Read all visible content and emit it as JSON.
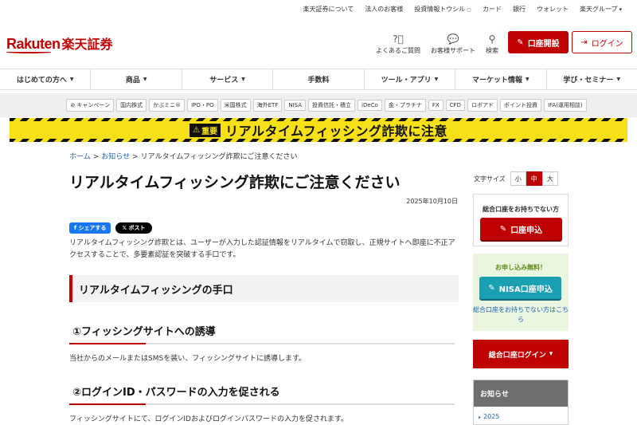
{
  "util_links": [
    "楽天証券について",
    "法人のお客様",
    "投資情報トウシル",
    "カード",
    "銀行",
    "ウォレット",
    "楽天グループ"
  ],
  "logo": {
    "en": "Rakuten",
    "jp": "楽天証券"
  },
  "header_icons": [
    {
      "icon": "question-icon",
      "label": "よくあるご質問"
    },
    {
      "icon": "chat-icon",
      "label": "お客様サポート"
    },
    {
      "icon": "search-icon",
      "label": "検索"
    }
  ],
  "open_account_label": "口座開設",
  "login_label": "ログイン",
  "gnav": [
    "はじめての方へ",
    "商品",
    "サービス",
    "手数料",
    "ツール・アプリ",
    "マーケット情報",
    "学び・セミナー"
  ],
  "gnav_has_caret": [
    true,
    true,
    true,
    false,
    true,
    true,
    true
  ],
  "subnav": [
    "キャンペーン",
    "国内株式",
    "かぶミニ®",
    "IPO・PO",
    "米国株式",
    "海外ETF",
    "NISA",
    "投資信託・積立",
    "iDeCo",
    "金・プラチナ",
    "FX",
    "CFD",
    "ロボアド",
    "ポイント投資",
    "IFA(運用相談)"
  ],
  "banner": {
    "tag": "重要",
    "message": "リアルタイムフィッシング詐欺に注意"
  },
  "breadcrumb": {
    "home": "ホーム",
    "news": "お知らせ",
    "current": "リアルタイムフィッシング詐欺にご注意ください"
  },
  "article": {
    "title": "リアルタイムフィッシング詐欺にご注意ください",
    "date": "2025年10月10日",
    "share_fb": "シェアする",
    "share_x": "ポスト",
    "intro": "リアルタイムフィッシング詐欺とは、ユーザーが入力した認証情報をリアルタイムで窃取し、正規サイトへ即座に不正アクセスすることで、多要素認証を突破する手口です。",
    "h2": "リアルタイムフィッシングの手口",
    "step1_title": "①フィッシングサイトへの誘導",
    "step1_text": "当社からのメールまたはSMSを装い、フィッシングサイトに誘導します。",
    "step2_title": "②ログインID・パスワードの入力を促される",
    "step2_text": "フィッシングサイトにて、ログインIDおよびログインパスワードの入力を促されます。"
  },
  "sidebar": {
    "fontsize_label": "文字サイズ",
    "fontsize_options": [
      "小",
      "中",
      "大"
    ],
    "fontsize_selected": "中",
    "no_account_text": "総合口座をお持ちでない方",
    "apply_label": "口座申込",
    "free_text": "お申し込み無料！",
    "nisa_label": "NISA口座申込",
    "nisa_note": "総合口座をお持ちでない方はこちら",
    "login_label": "総合口座ログイン",
    "news_header": "お知らせ",
    "news_item": "2025"
  },
  "colors": {
    "brand": "#bf0000",
    "nisa": "#1b9fb3",
    "banner": "#f7e017"
  }
}
